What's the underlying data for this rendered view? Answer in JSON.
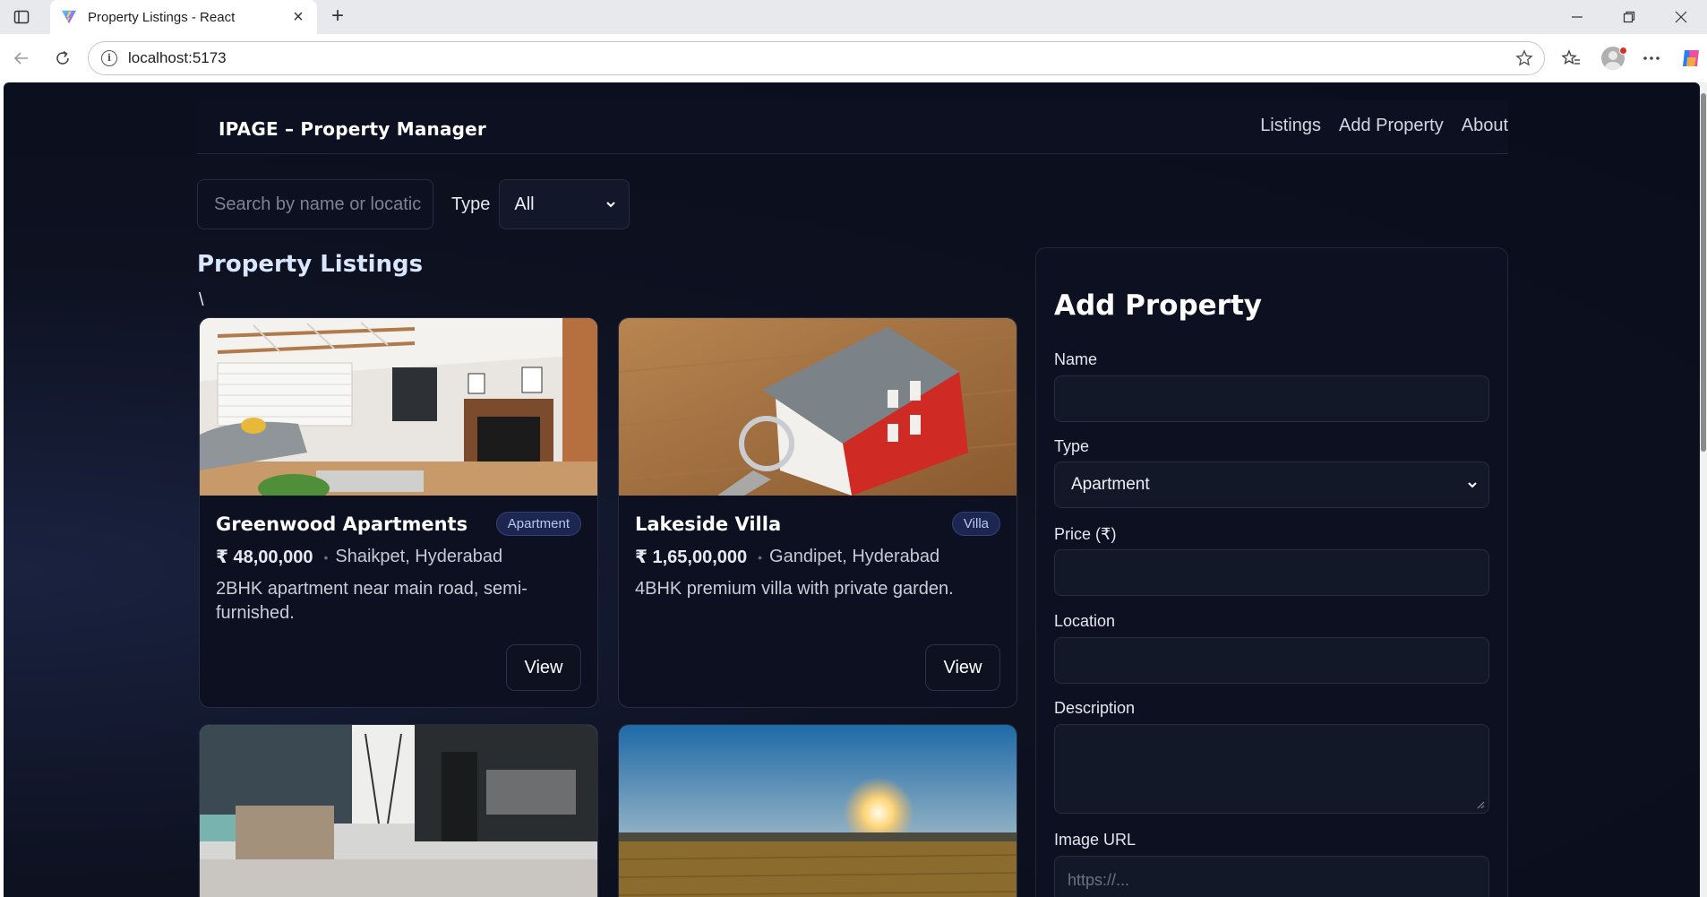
{
  "browser": {
    "tab_title": "Property Listings - React",
    "url": "localhost:5173"
  },
  "app": {
    "brand": "IPAGE – Property Manager",
    "nav": [
      "Listings",
      "Add Property",
      "About"
    ]
  },
  "filters": {
    "search_placeholder": "Search by name or locatic",
    "type_label": "Type",
    "type_value": "All"
  },
  "listings": {
    "title": "Property Listings",
    "stray_char": "\\",
    "view_label": "View",
    "cards": [
      {
        "name": "Greenwood Apartments",
        "badge": "Apartment",
        "price": "₹ 48,00,000",
        "location": "Shaikpet, Hyderabad",
        "description": "2BHK apartment near main road, semi-furnished."
      },
      {
        "name": "Lakeside Villa",
        "badge": "Villa",
        "price": "₹ 1,65,00,000",
        "location": "Gandipet, Hyderabad",
        "description": "4BHK premium villa with private garden."
      }
    ]
  },
  "form": {
    "title": "Add Property",
    "name_label": "Name",
    "type_label": "Type",
    "type_value": "Apartment",
    "price_label": "Price (₹)",
    "location_label": "Location",
    "description_label": "Description",
    "image_label": "Image URL",
    "image_placeholder": "https://..."
  }
}
